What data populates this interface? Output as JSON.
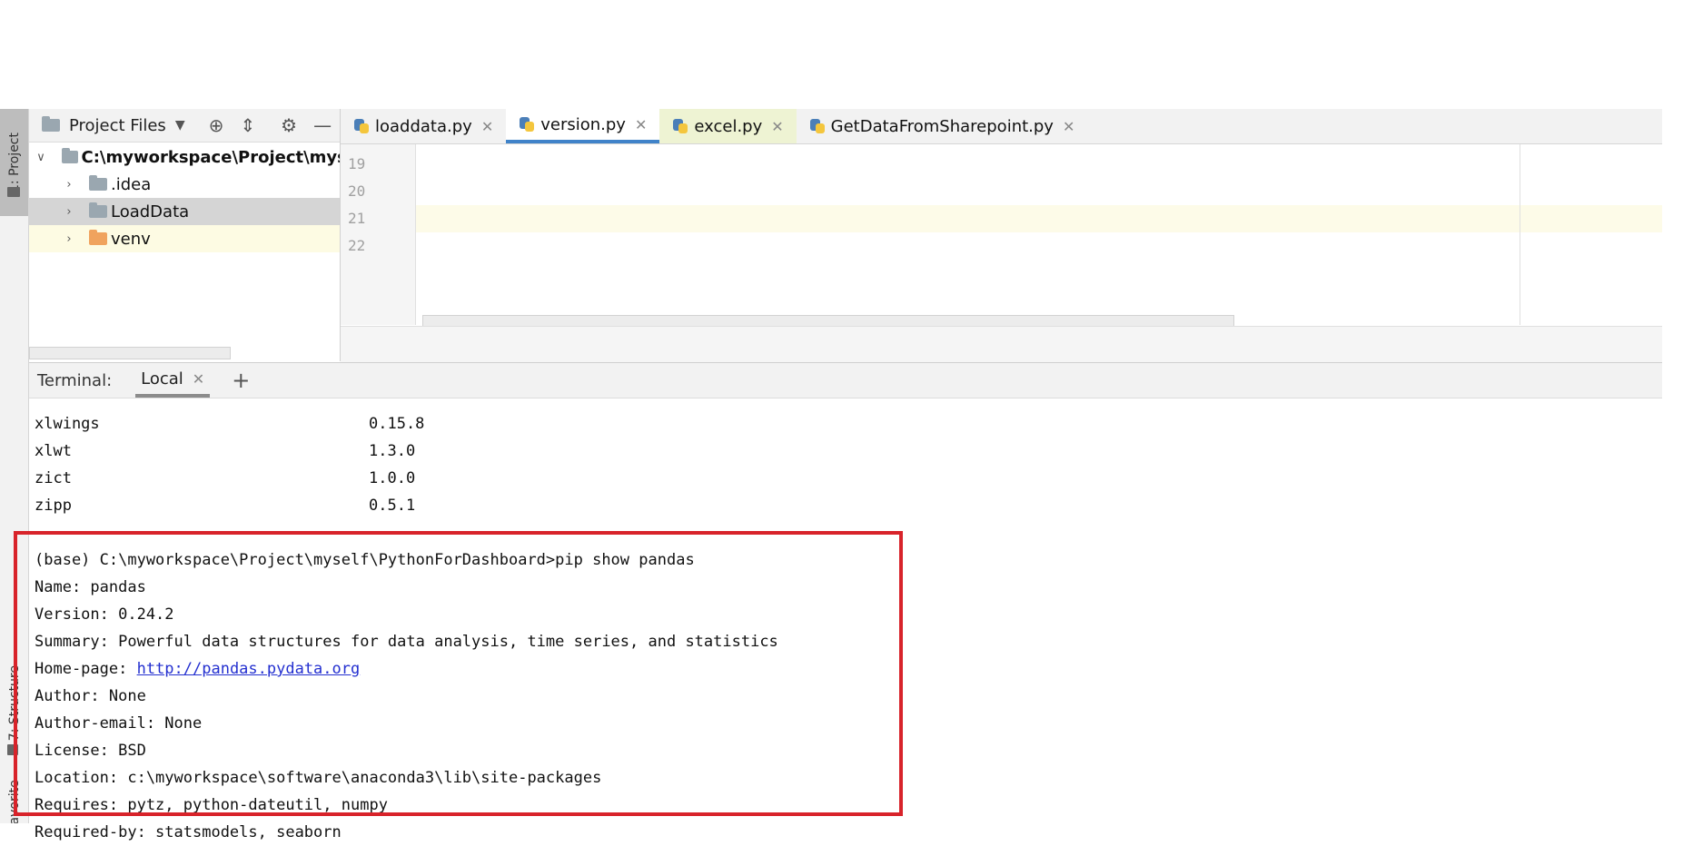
{
  "sidebar": {
    "project_tab": "1: Project",
    "structure_tab": "7: Structure",
    "favorites_tab": "Favorites"
  },
  "project_panel": {
    "title": "Project Files",
    "tree": [
      {
        "label": "C:\\myworkspace\\Project\\myself\\",
        "expanded": true
      },
      {
        "label": ".idea"
      },
      {
        "label": "LoadData"
      },
      {
        "label": "venv"
      }
    ]
  },
  "editor": {
    "tabs": [
      {
        "label": "loaddata.py"
      },
      {
        "label": "version.py"
      },
      {
        "label": "excel.py"
      },
      {
        "label": "GetDataFromSharepoint.py"
      }
    ],
    "line_numbers": [
      "19",
      "20",
      "21",
      "22"
    ]
  },
  "terminal": {
    "label": "Terminal:",
    "tab": "Local",
    "packages": [
      {
        "name": "xlwings",
        "version": "0.15.8"
      },
      {
        "name": "xlwt",
        "version": "1.3.0"
      },
      {
        "name": "zict",
        "version": "1.0.0"
      },
      {
        "name": "zipp",
        "version": "0.5.1"
      }
    ],
    "command": "(base) C:\\myworkspace\\Project\\myself\\PythonForDashboard>pip show pandas",
    "info": {
      "name": "Name: pandas",
      "version": "Version: 0.24.2",
      "summary": "Summary: Powerful data structures for data analysis, time series, and statistics",
      "homepage_label": "Home-page: ",
      "homepage_url": "http://pandas.pydata.org",
      "author": "Author: None",
      "author_email": "Author-email: None",
      "license": "License: BSD",
      "location": "Location: c:\\myworkspace\\software\\anaconda3\\lib\\site-packages",
      "requires": "Requires: pytz, python-dateutil, numpy",
      "required_by": "Required-by: statsmodels, seaborn"
    }
  },
  "colors": {
    "highlight_border": "#d8232a",
    "active_tab_underline": "#4083c9",
    "link": "#2430d0"
  }
}
